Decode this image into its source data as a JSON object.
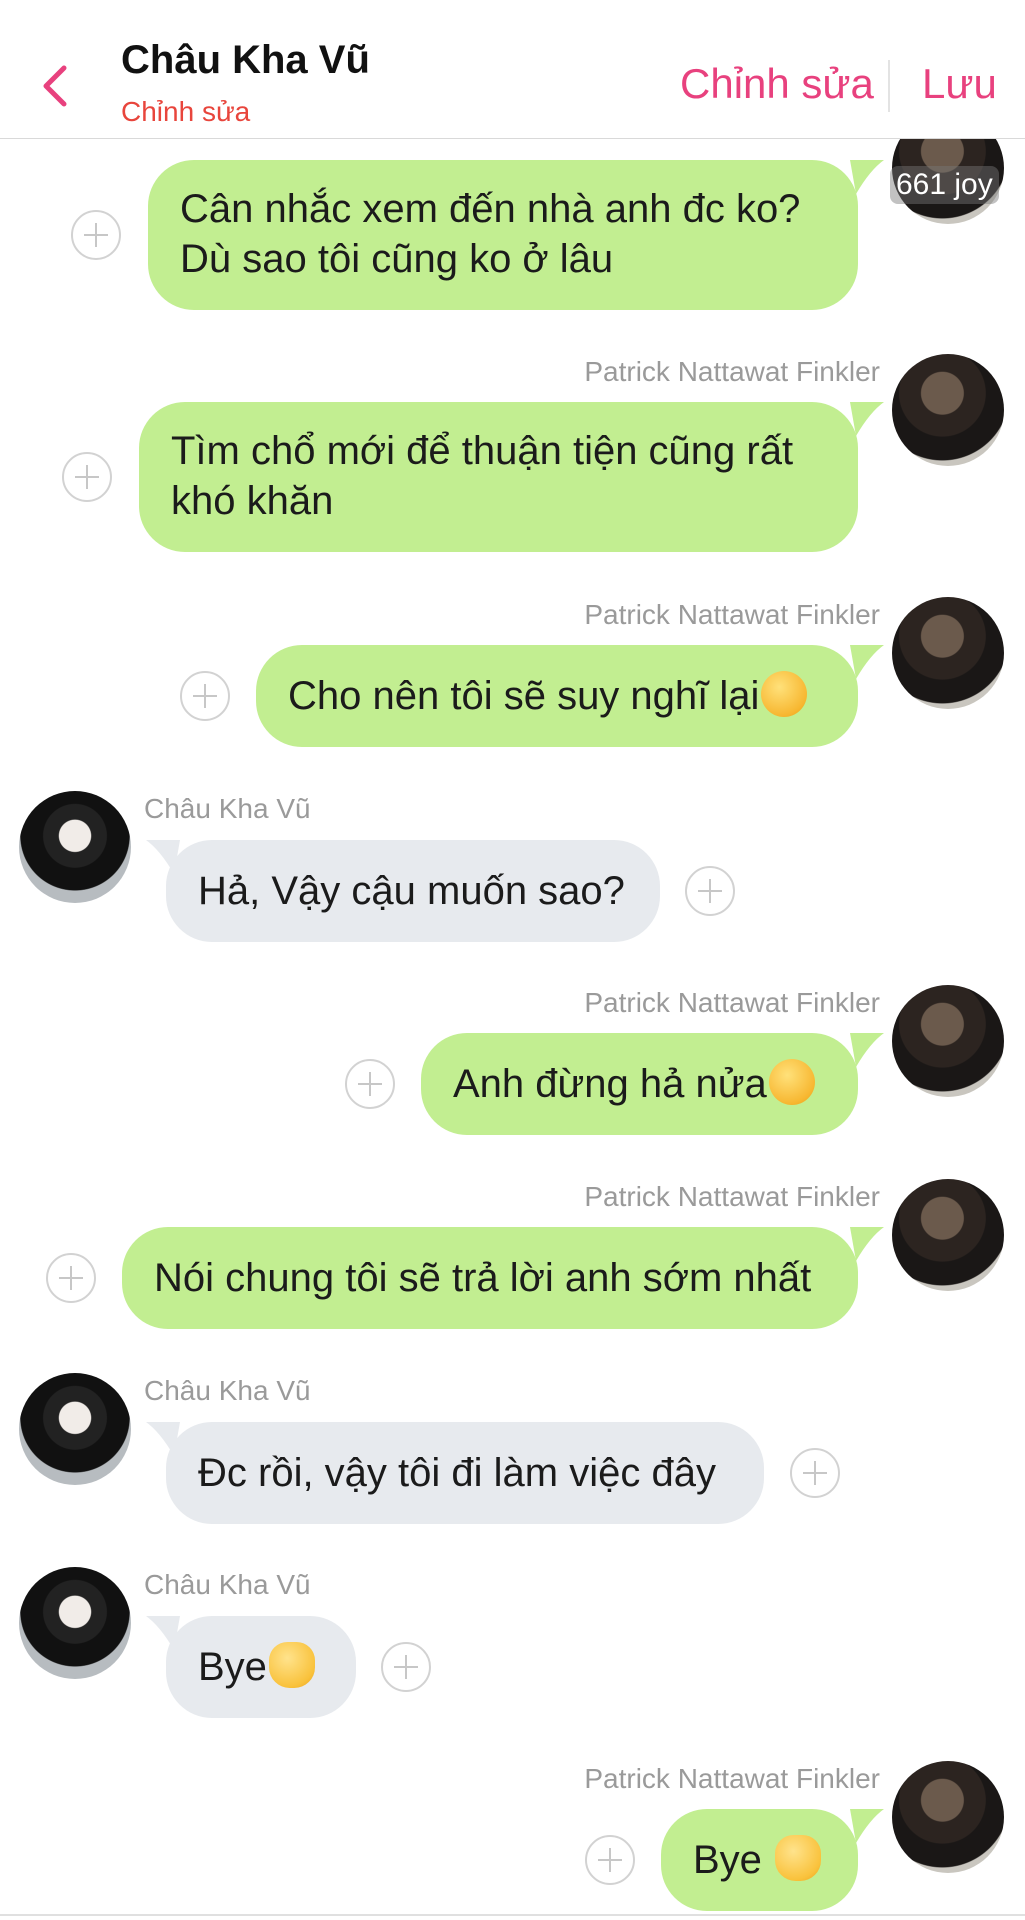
{
  "header": {
    "title": "Châu Kha Vũ",
    "subtitle": "Chỉnh sửa",
    "edit_label": "Chỉnh sửa",
    "save_label": "Lưu",
    "accent": "#e8417e"
  },
  "watermark": "661 joy",
  "messages": [
    {
      "sender": "",
      "text_line1": "Cân nhắc xem đến nhà anh đc ko?",
      "text_line2": "Dù sao tôi cũng ko ở lâu",
      "side": "right"
    },
    {
      "sender": "Patrick Nattawat Finkler",
      "text_line1": "Tìm chổ mới để thuận tiện cũng rất",
      "text_line2": "khó khăn",
      "side": "right"
    },
    {
      "sender": "Patrick Nattawat Finkler",
      "text": "Cho nên tôi sẽ suy nghĩ lại",
      "emoji": "thinking-face",
      "side": "right"
    },
    {
      "sender": "Châu Kha Vũ",
      "text": "Hả, Vậy cậu muốn sao?",
      "side": "left"
    },
    {
      "sender": "Patrick Nattawat Finkler",
      "text": "Anh đừng hả nửa",
      "emoji": "kissing-face",
      "side": "right"
    },
    {
      "sender": "Patrick Nattawat Finkler",
      "text": "Nói chung tôi sẽ trả lời anh sớm nhất",
      "side": "right"
    },
    {
      "sender": "Châu Kha Vũ",
      "text": "Đc rồi, vậy tôi đi làm việc đây",
      "side": "left"
    },
    {
      "sender": "Châu Kha Vũ",
      "text": "Bye",
      "emoji": "waving-hand",
      "side": "left"
    },
    {
      "sender": "Patrick Nattawat Finkler",
      "text": "Bye ",
      "emoji": "waving-hand",
      "side": "right"
    }
  ],
  "colors": {
    "outgoing_bubble": "#c2ee91",
    "incoming_bubble": "#e7eaee",
    "sender_name": "#9a9a9a",
    "subtitle": "#e8453c"
  }
}
